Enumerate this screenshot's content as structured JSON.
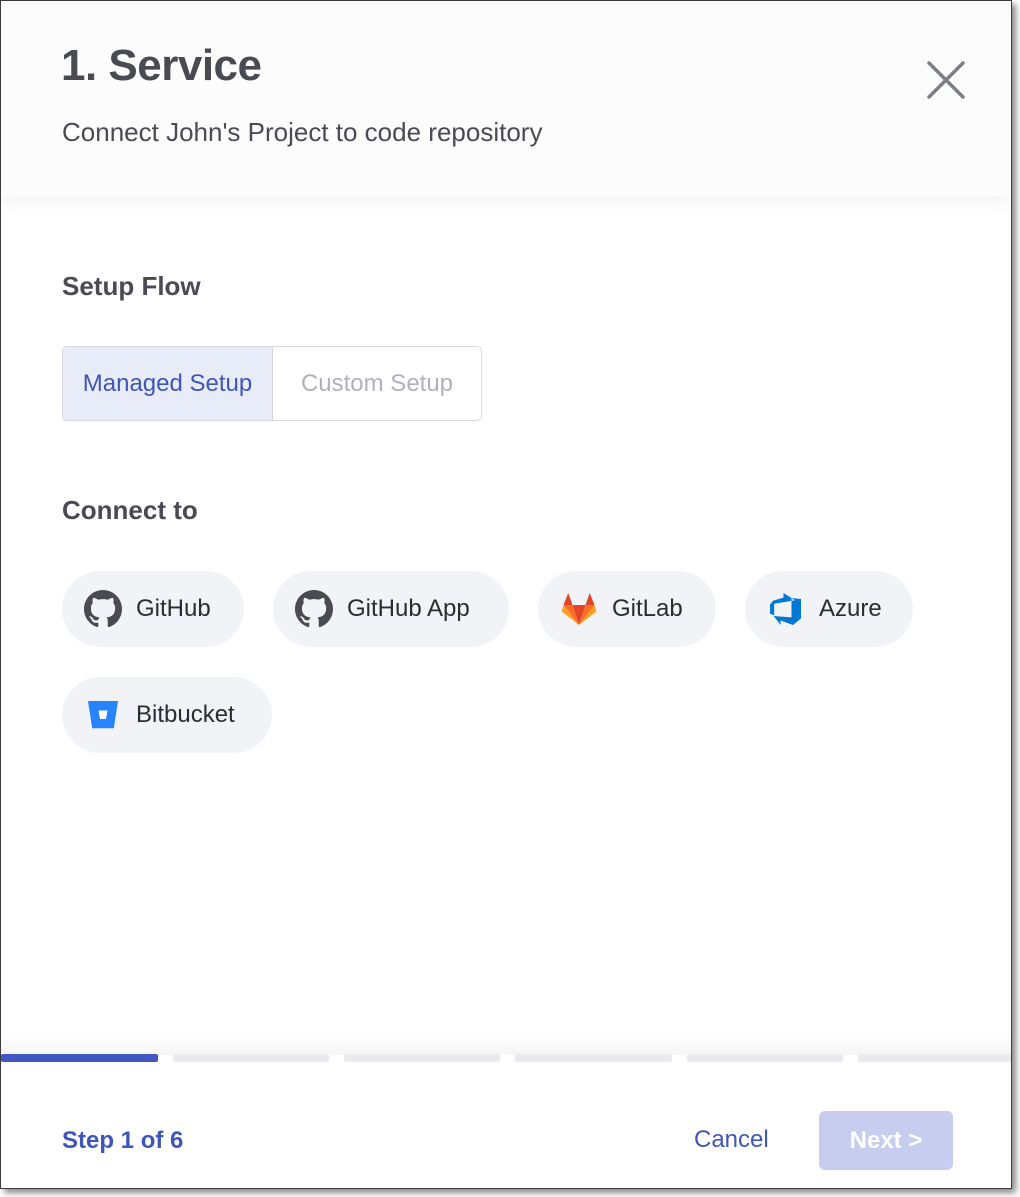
{
  "header": {
    "title": "1. Service",
    "subtitle": "Connect John's Project to code repository"
  },
  "setup_flow": {
    "label": "Setup Flow",
    "options": [
      {
        "label": "Managed Setup",
        "selected": true
      },
      {
        "label": "Custom Setup",
        "selected": false
      }
    ]
  },
  "connect": {
    "label": "Connect to",
    "providers": [
      {
        "label": "GitHub",
        "icon": "github-icon"
      },
      {
        "label": "GitHub App",
        "icon": "github-icon"
      },
      {
        "label": "GitLab",
        "icon": "gitlab-icon"
      },
      {
        "label": "Azure",
        "icon": "azure-icon"
      },
      {
        "label": "Bitbucket",
        "icon": "bitbucket-icon"
      }
    ]
  },
  "progress": {
    "current_step": 1,
    "total_steps": 6
  },
  "footer": {
    "step_text": "Step 1 of 6",
    "cancel_label": "Cancel",
    "next_label": "Next >"
  },
  "colors": {
    "accent": "#3f56b9",
    "next_disabled_bg": "#c7cdee",
    "pill_bg": "#f2f3f7"
  }
}
